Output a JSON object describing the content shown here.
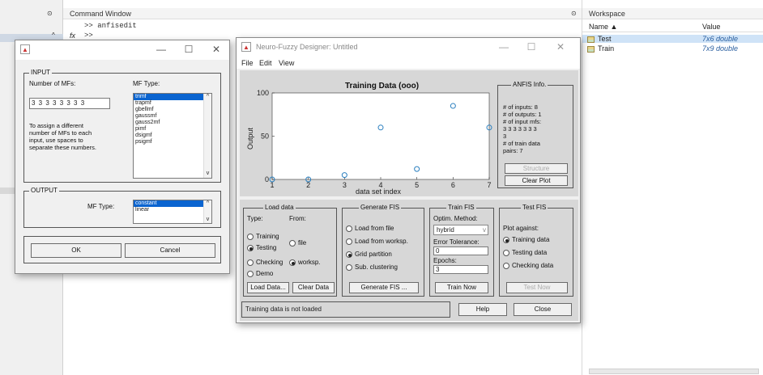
{
  "matlab": {
    "command_window_title": "Command Window",
    "cmd_line1": ">> anfisedit",
    "cmd_line2": ">>",
    "fx_symbol": "fx",
    "workspace_title": "Workspace",
    "ws_col_name": "Name ▲",
    "ws_col_value": "Value",
    "ws_rows": [
      {
        "name": "Test",
        "value": "7x6 double"
      },
      {
        "name": "Train",
        "value": "7x9 double"
      }
    ]
  },
  "mf_dialog": {
    "input_group": "INPUT",
    "num_mfs_label": "Number of MFs:",
    "mf_type_label": "MF Type:",
    "num_mfs_value": "3 3 3 3 3 3 3 3",
    "hint": [
      "To assign a different",
      "number of MFs to each",
      "input, use spaces to",
      "separate these numbers."
    ],
    "mf_types": [
      "trimf",
      "trapmf",
      "gbellmf",
      "gaussmf",
      "gauss2mf",
      "pimf",
      "dsigmf",
      "psigmf"
    ],
    "output_group": "OUTPUT",
    "output_mf_type_label": "MF Type:",
    "output_types": [
      "constant",
      "linear"
    ],
    "ok_label": "OK",
    "cancel_label": "Cancel"
  },
  "nfd": {
    "title": "Neuro-Fuzzy Designer: Untitled",
    "menu": [
      "File",
      "Edit",
      "View"
    ],
    "plot_title": "Training Data (ooo)",
    "ylabel": "Output",
    "xlabel": "data set index",
    "x_ticks": [
      "1",
      "2",
      "3",
      "4",
      "5",
      "6",
      "7"
    ],
    "y_ticks": [
      "0",
      "50",
      "100"
    ],
    "anfis_info": {
      "title": "ANFIS Info.",
      "lines": [
        "# of inputs: 8",
        "# of outputs: 1",
        "# of input mfs:",
        "3 3 3 3 3 3 3",
        "3",
        "# of train data",
        "pairs: 7"
      ],
      "structure_label": "Structure",
      "clear_plot_label": "Clear Plot"
    },
    "load_data": {
      "title": "Load data",
      "type_label": "Type:",
      "from_label": "From:",
      "types": [
        "Training",
        "Testing",
        "Checking",
        "Demo"
      ],
      "selected_type": "Testing",
      "sources": [
        "file",
        "worksp."
      ],
      "selected_source": "worksp.",
      "load_button": "Load Data...",
      "clear_button": "Clear Data"
    },
    "generate_fis": {
      "title": "Generate FIS",
      "options": [
        "Load from file",
        "Load from worksp.",
        "Grid partition",
        "Sub. clustering"
      ],
      "selected": "Grid partition",
      "button": "Generate FIS ..."
    },
    "train_fis": {
      "title": "Train FIS",
      "optim_label": "Optim. Method:",
      "method": "hybrid",
      "error_label": "Error Tolerance:",
      "error_value": "0",
      "epochs_label": "Epochs:",
      "epochs_value": "3",
      "button": "Train Now"
    },
    "test_fis": {
      "title": "Test FIS",
      "plot_against": "Plot against:",
      "options": [
        "Training data",
        "Testing data",
        "Checking data"
      ],
      "selected": "Training data",
      "button": "Test Now"
    },
    "status": "Training data is not loaded",
    "help_label": "Help",
    "close_label": "Close"
  },
  "chart_data": {
    "type": "scatter",
    "title": "Training Data (ooo)",
    "xlabel": "data set index",
    "ylabel": "Output",
    "x": [
      1,
      2,
      3,
      4,
      5,
      6,
      7
    ],
    "y": [
      0,
      0,
      5,
      60,
      12,
      85,
      60
    ],
    "xlim": [
      1,
      7
    ],
    "ylim": [
      0,
      100
    ],
    "marker_color": "#2a7fbf"
  }
}
